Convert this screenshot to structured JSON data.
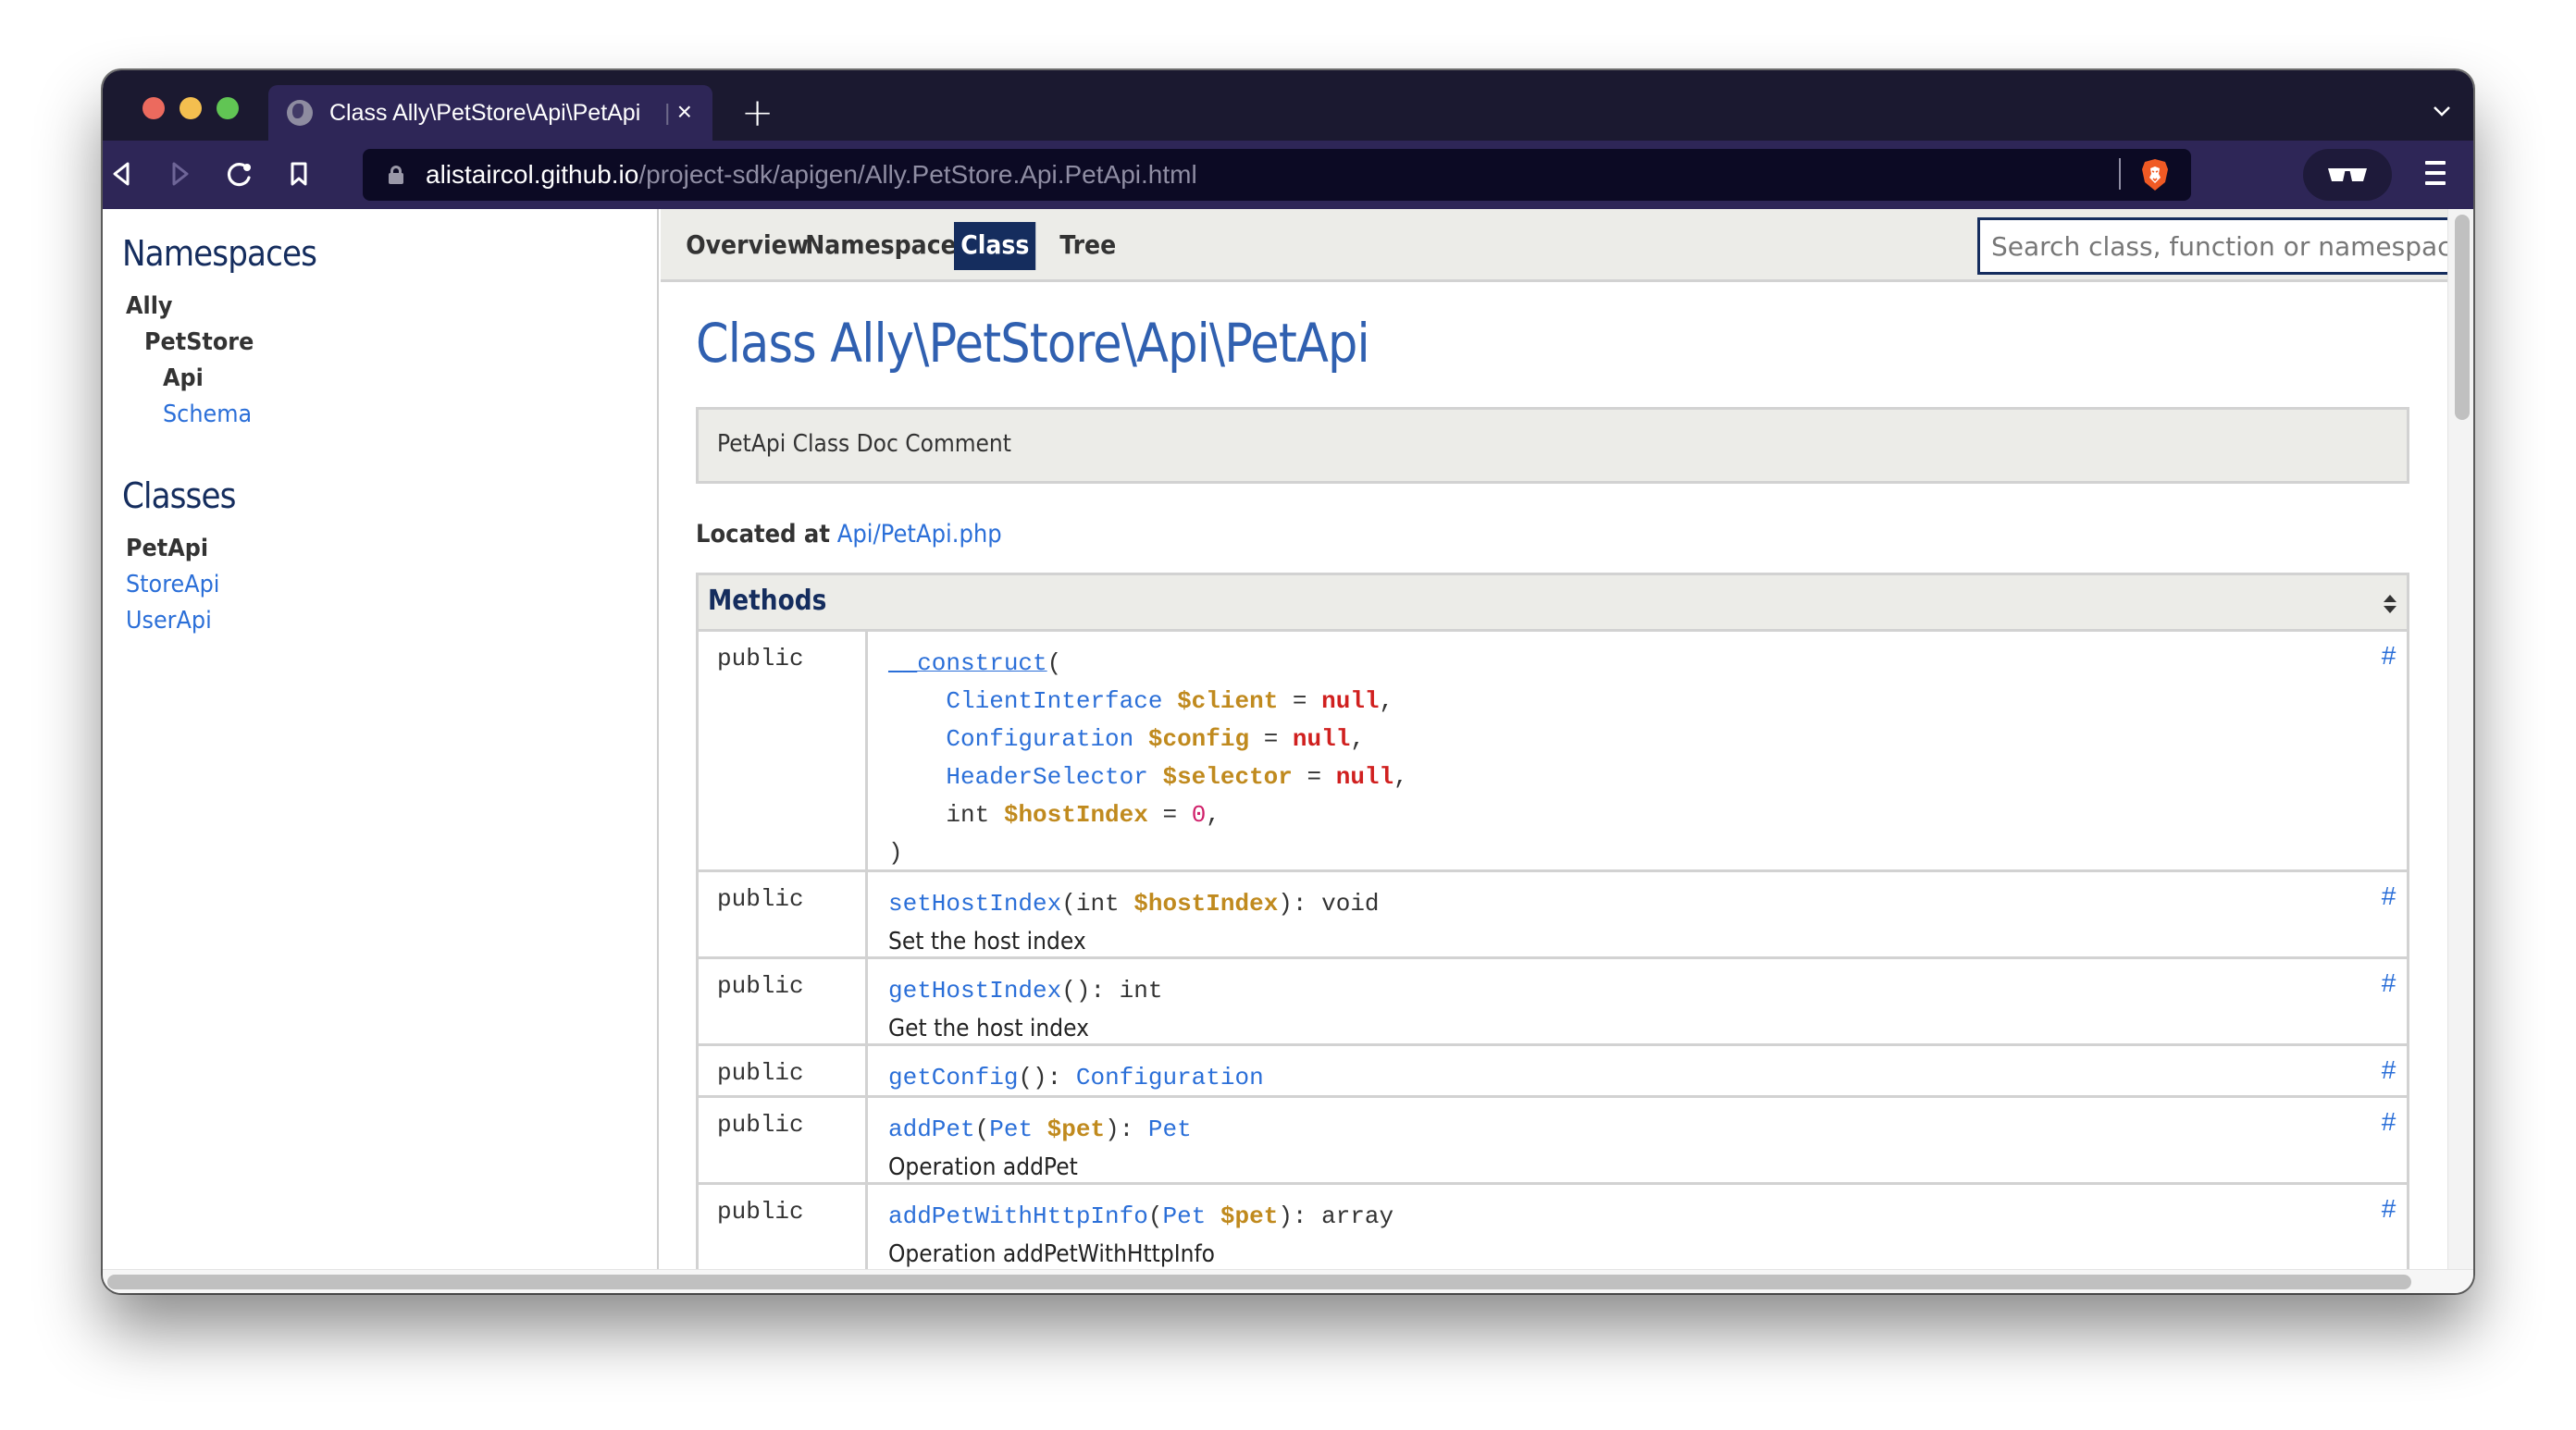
{
  "browser": {
    "tab_title": "Class Ally\\PetStore\\Api\\PetApi",
    "tab_separator": "|",
    "close_glyph": "×",
    "new_tab_glyph": "+",
    "tab_menu_glyph": "⌄",
    "url_host": "alistaircol.github.io",
    "url_path": "/project-sdk/apigen/Ally.PetStore.Api.PetApi.html",
    "icons": [
      "back-icon",
      "forward-icon",
      "reload-icon",
      "bookmark-icon",
      "lock-icon",
      "brave-shield-icon",
      "private-glasses-icon",
      "menu-icon"
    ]
  },
  "sidebar": {
    "namespaces_title": "Namespaces",
    "namespaces": [
      {
        "label": "Ally",
        "current": true,
        "depth": 0
      },
      {
        "label": "PetStore",
        "current": true,
        "depth": 1
      },
      {
        "label": "Api",
        "current": true,
        "depth": 2
      },
      {
        "label": "Schema",
        "current": false,
        "depth": 2
      }
    ],
    "classes_title": "Classes",
    "classes": [
      {
        "label": "PetApi",
        "current": true
      },
      {
        "label": "StoreApi",
        "current": false
      },
      {
        "label": "UserApi",
        "current": false
      }
    ]
  },
  "topnav": {
    "items": [
      {
        "label": "Overview",
        "active": false
      },
      {
        "label": "Namespace",
        "active": false
      },
      {
        "label": "Class",
        "active": true
      },
      {
        "label": "Tree",
        "active": false
      }
    ],
    "search_placeholder": "Search class, function or namespace",
    "search_value": ""
  },
  "main": {
    "title": "Class Ally\\PetStore\\Api\\PetApi",
    "doc_comment": "PetApi Class Doc Comment",
    "located_label": "Located at",
    "located_link": "Api/PetApi.php",
    "methods_title": "Methods",
    "anchor_glyph": "#",
    "methods": [
      {
        "modifier": "public",
        "name": "__construct",
        "params": [
          {
            "type": "ClientInterface",
            "var": "$client",
            "default": "null"
          },
          {
            "type": "Configuration",
            "var": "$config",
            "default": "null"
          },
          {
            "type": "HeaderSelector",
            "var": "$selector",
            "default": "null"
          },
          {
            "type": "int",
            "var": "$hostIndex",
            "default": "0"
          }
        ],
        "close": ")"
      },
      {
        "modifier": "public",
        "name": "setHostIndex",
        "param_type": "int",
        "param_var": "$hostIndex",
        "returns": "void",
        "description": "Set the host index"
      },
      {
        "modifier": "public",
        "name": "getHostIndex",
        "returns": "int",
        "description": "Get the host index"
      },
      {
        "modifier": "public",
        "name": "getConfig",
        "returns": "Configuration"
      },
      {
        "modifier": "public",
        "name": "addPet",
        "param_type": "Pet",
        "param_var": "$pet",
        "returns": "Pet",
        "description": "Operation addPet"
      },
      {
        "modifier": "public",
        "name": "addPetWithHttpInfo",
        "param_type": "Pet",
        "param_var": "$pet",
        "returns": "array",
        "description": "Operation addPetWithHttpInfo"
      }
    ]
  },
  "colors": {
    "tabbar_bg": "#1b1930",
    "toolbar_bg": "#2e2657",
    "url_bg": "#0c0a24",
    "brand_navy": "#152d5e",
    "link_blue": "#2b6fd8",
    "title_blue": "#3060b0",
    "variable_gold": "#c08a1e",
    "null_red": "#d0201f",
    "number_pink": "#d0206a",
    "panel_bg": "#ecece8"
  }
}
